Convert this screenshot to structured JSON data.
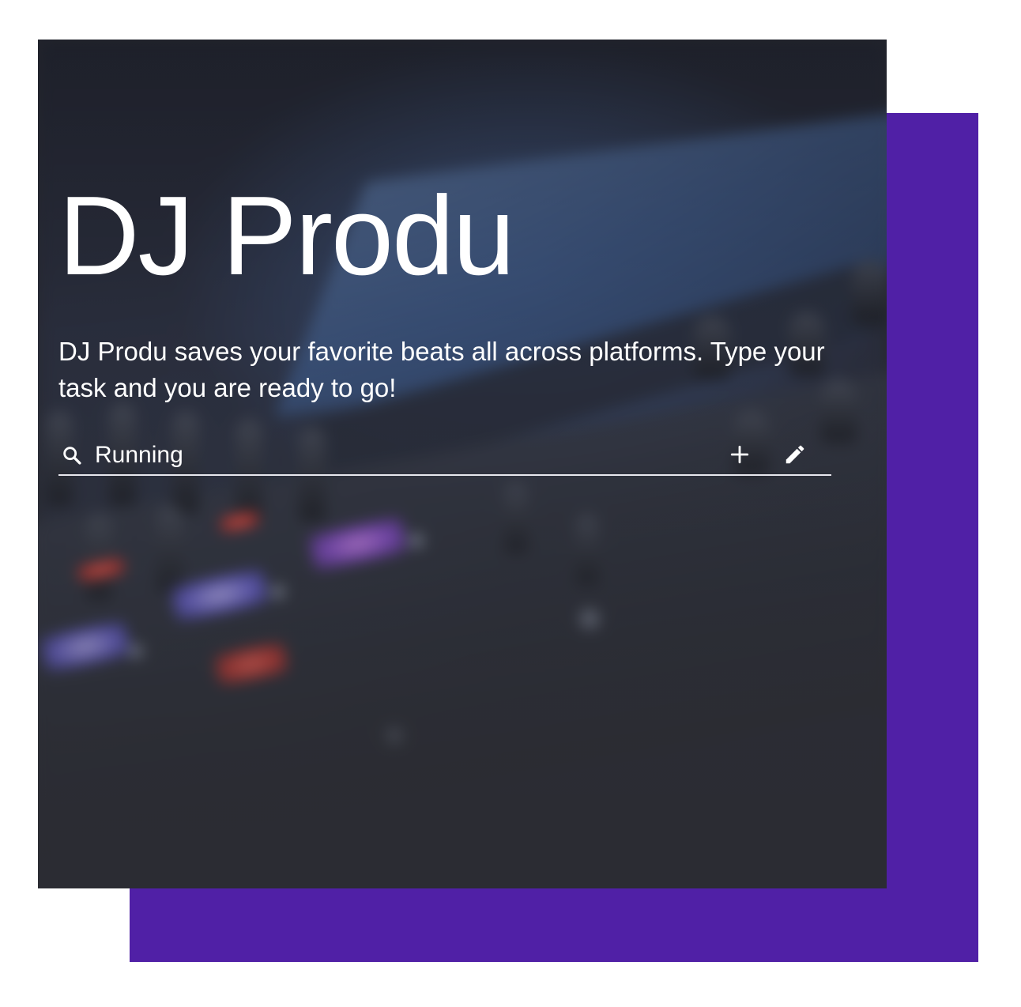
{
  "app": {
    "title": "DJ Produ",
    "description": "DJ Produ saves your favorite beats all across platforms. Type your task and you are ready to go!"
  },
  "task_bar": {
    "value": "Running",
    "icons": {
      "search": "search-icon",
      "add": "plus-icon",
      "edit": "pencil-icon"
    }
  },
  "colors": {
    "accent": "#5020a6",
    "card_background": "#2b2c33",
    "text": "#ffffff",
    "underline": "#e8e8ee"
  }
}
